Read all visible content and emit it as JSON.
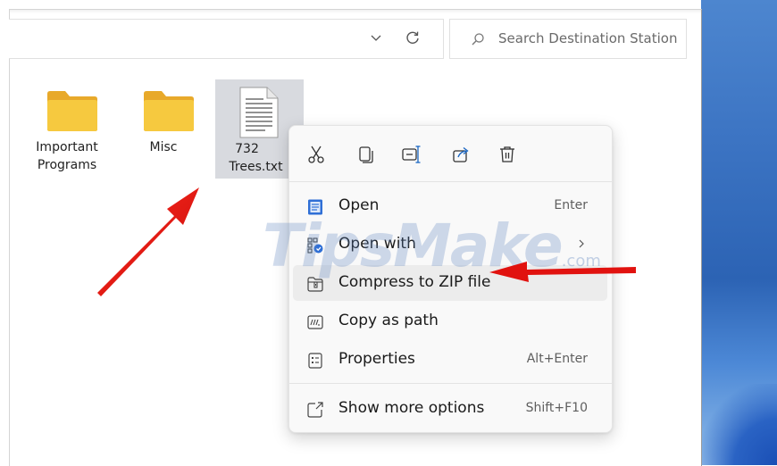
{
  "search": {
    "placeholder": "Search Destination Station"
  },
  "files": [
    {
      "label_line1": "Important",
      "label_line2": "Programs",
      "icon": "folder-icon"
    },
    {
      "label_line1": "Misc",
      "label_line2": "",
      "icon": "folder-icon"
    },
    {
      "label_line1": "732",
      "label_line2": "Trees.txt",
      "icon": "text-file-icon"
    }
  ],
  "context_menu": {
    "toolbar": [
      "cut-icon",
      "copy-icon",
      "rename-icon",
      "share-icon",
      "delete-icon"
    ],
    "items": [
      {
        "label": "Open",
        "shortcut": "Enter",
        "icon": "notepad-icon"
      },
      {
        "label": "Open with",
        "shortcut": "",
        "icon": "open-with-icon",
        "submenu": true
      },
      {
        "label": "Compress to ZIP file",
        "shortcut": "",
        "icon": "zip-icon",
        "highlighted": true
      },
      {
        "label": "Copy as path",
        "shortcut": "",
        "icon": "copy-path-icon"
      },
      {
        "label": "Properties",
        "shortcut": "Alt+Enter",
        "icon": "properties-icon"
      },
      {
        "label": "Show more options",
        "shortcut": "Shift+F10",
        "icon": "show-more-icon"
      }
    ]
  },
  "watermark": {
    "text": "TipsMake",
    "suffix": ".com"
  },
  "colors": {
    "folder": "#f6c93f",
    "selection": "#d8dadf",
    "menu_bg": "#f9f9f9",
    "arrow": "#e1120f",
    "desktop": "#3c74c3"
  }
}
